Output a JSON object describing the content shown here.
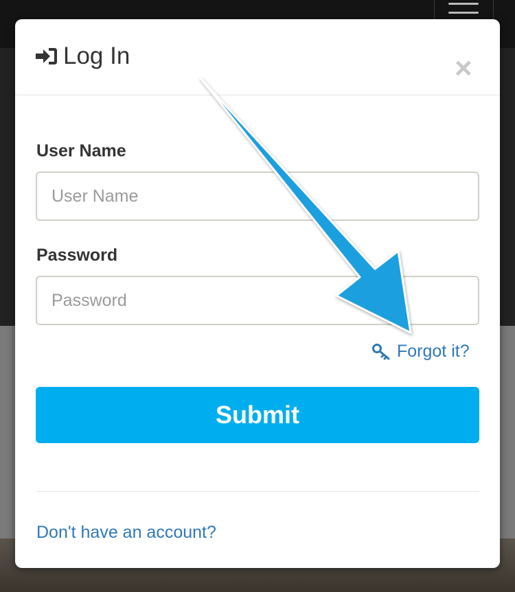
{
  "modal": {
    "title": "Log In",
    "title_icon": "sign-in-icon",
    "close_label": "×"
  },
  "form": {
    "username_label": "User Name",
    "username_placeholder": "User Name",
    "username_value": "",
    "password_label": "Password",
    "password_placeholder": "Password",
    "password_value": "",
    "forgot_label": "Forgot it?",
    "forgot_icon": "key-icon",
    "submit_label": "Submit"
  },
  "footer": {
    "signup_label": "Don't have an account?"
  },
  "colors": {
    "accent": "#00aeef",
    "link": "#2f78b8",
    "annotation_arrow": "#1e9fdf"
  }
}
